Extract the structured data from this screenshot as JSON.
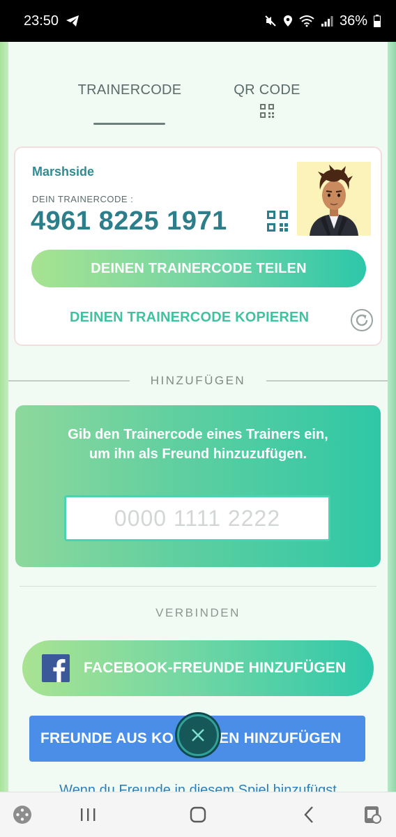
{
  "status_bar": {
    "time": "23:50",
    "battery": "36%",
    "icons": [
      "telegram-icon",
      "mute-icon",
      "location-icon",
      "wifi-icon",
      "signal-icon",
      "battery-icon"
    ]
  },
  "tabs": [
    {
      "label": "TRAINERCODE",
      "selected": true
    },
    {
      "label": "QR CODE",
      "selected": false
    }
  ],
  "trainer_card": {
    "username": "Marshside",
    "code_label": "DEIN TRAINERCODE :",
    "code": "4961 8225 1971",
    "share_label": "DEINEN TRAINERCODE TEILEN",
    "copy_label": "DEINEN TRAINERCODE KOPIEREN"
  },
  "add_section": {
    "heading": "HINZUFÜGEN",
    "instruction": "Gib den Trainercode eines Trainers ein, um ihn als Freund hinzuzufügen.",
    "input_placeholder": "0000 1111 2222"
  },
  "connect_section": {
    "heading": "VERBINDEN",
    "facebook_label": "FACEBOOK-FREUNDE HINZUFÜGEN",
    "contacts_label": "FREUNDE AUS KO",
    "contacts_label_rest": "TEN HINZUFÜGEN",
    "footer_text": "Wenn du Freunde in diesem Spiel hinzufügst"
  },
  "colors": {
    "accent_teal": "#2c7f8a",
    "accent_green": "#40c2a0",
    "contacts_blue": "#4a8ee8",
    "facebook_blue": "#3b5998"
  },
  "nav_bar": [
    "game-launcher-icon",
    "recent-apps-icon",
    "home-icon",
    "back-icon",
    "screenshot-assistant-icon"
  ]
}
